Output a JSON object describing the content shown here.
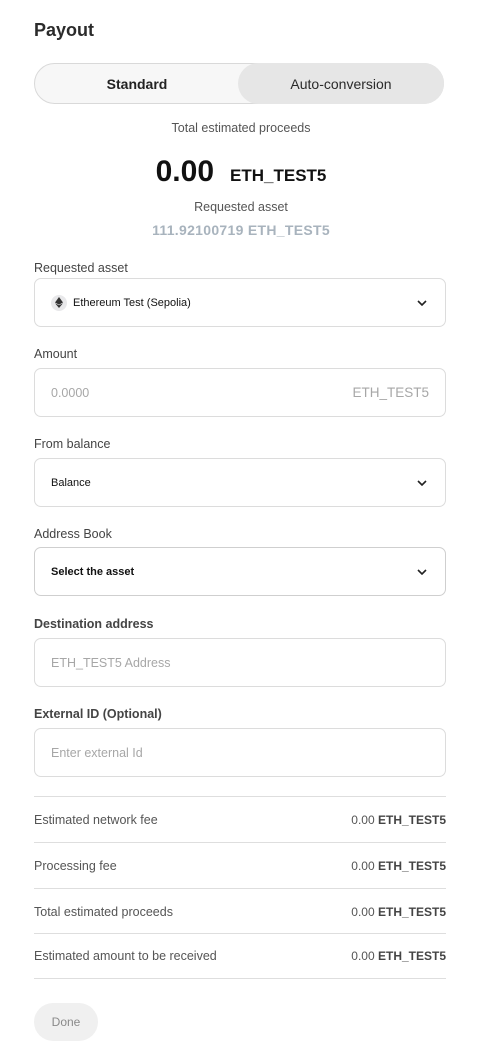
{
  "header": {
    "title": "Payout"
  },
  "toggle": {
    "standard": "Standard",
    "auto_conversion": "Auto-conversion",
    "selected": "Auto-conversion"
  },
  "summary": {
    "total_label": "Total estimated proceeds",
    "total_amount": "0.00",
    "total_unit": "ETH_TEST5",
    "requested_label": "Requested asset",
    "requested_value": "111.92100719 ETH_TEST5"
  },
  "form": {
    "requested_asset": {
      "label": "Requested asset",
      "value": "Ethereum Test (Sepolia)",
      "icon": "ethereum-icon"
    },
    "amount": {
      "label": "Amount",
      "placeholder": "0.0000",
      "unit": "ETH_TEST5"
    },
    "from_balance": {
      "label": "From balance",
      "value": "Balance"
    },
    "address_book": {
      "label": "Address Book",
      "value": "Select the asset"
    },
    "destination": {
      "label": "Destination address",
      "placeholder": "ETH_TEST5 Address"
    },
    "external_id": {
      "label": "External ID (Optional)",
      "placeholder": "Enter external Id"
    }
  },
  "fees": [
    {
      "label": "Estimated network fee",
      "amount": "0.00",
      "unit": "ETH_TEST5"
    },
    {
      "label": "Processing fee",
      "amount": "0.00",
      "unit": "ETH_TEST5"
    },
    {
      "label": "Total estimated proceeds",
      "amount": "0.00",
      "unit": "ETH_TEST5"
    },
    {
      "label": "Estimated amount to be received",
      "amount": "0.00",
      "unit": "ETH_TEST5"
    }
  ],
  "actions": {
    "done": "Done"
  },
  "colors": {
    "muted_value": "#a8b3bd",
    "toggle_active_bg": "#e6e6e6",
    "done_bg": "#f0f0f0"
  }
}
